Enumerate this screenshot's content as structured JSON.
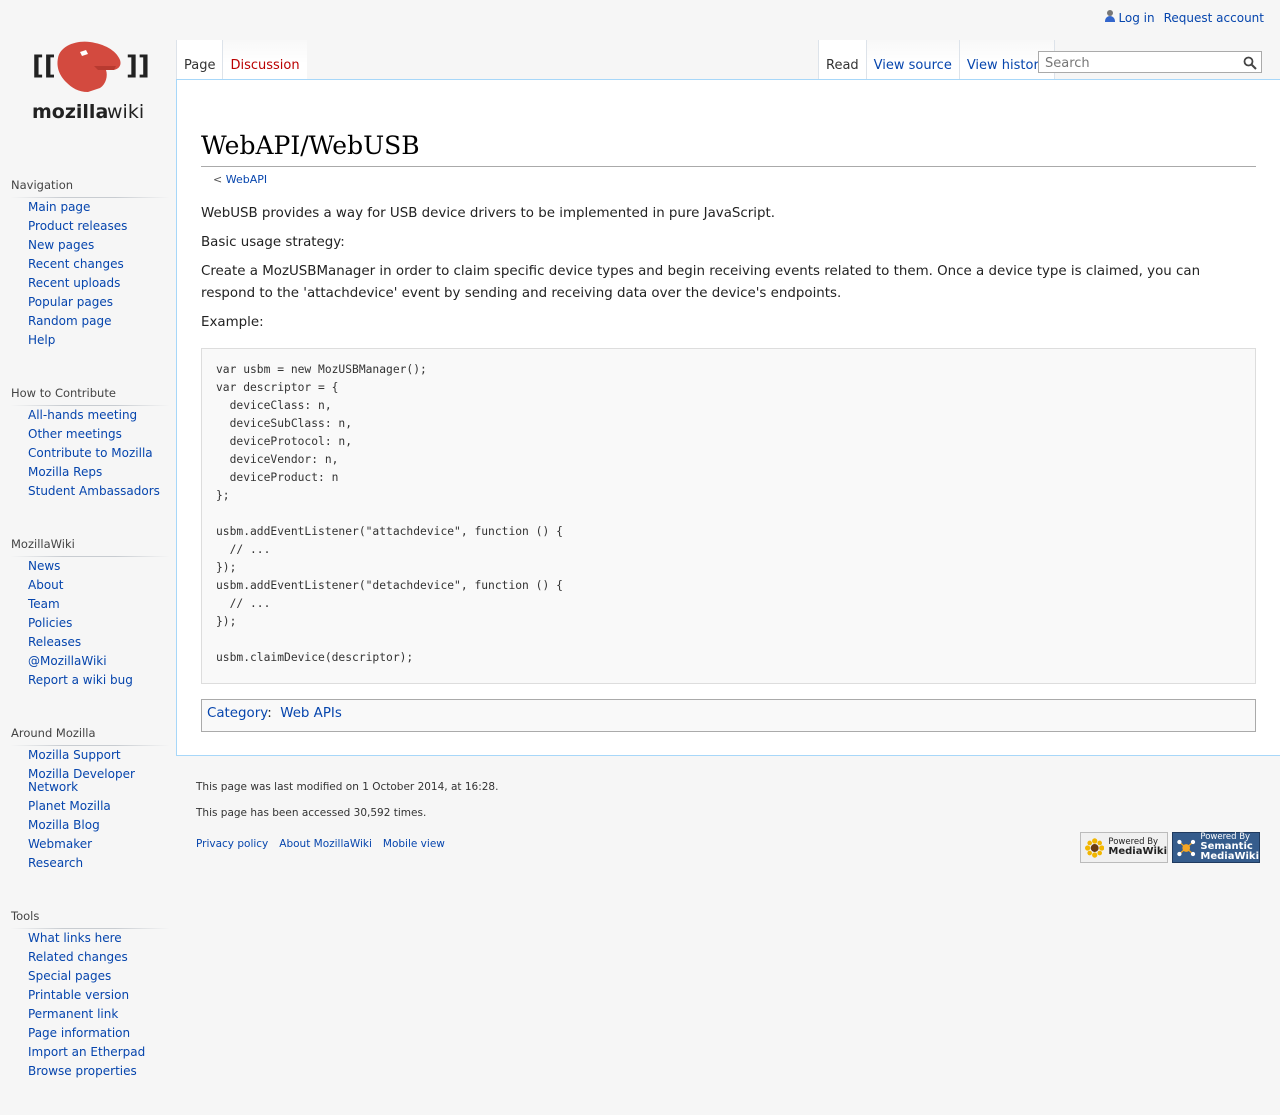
{
  "personal": {
    "login": "Log in",
    "request_account": "Request account"
  },
  "logo": {
    "brackets_left": "[[",
    "brackets_right": "]]",
    "wordmark_bold": "mozilla",
    "wordmark_light": "wiki"
  },
  "tabs_left": [
    "Page",
    "Discussion"
  ],
  "tabs_right": [
    "Read",
    "View source",
    "View history"
  ],
  "search": {
    "placeholder": "Search",
    "button_icon": "search-icon"
  },
  "page": {
    "title": "WebAPI/WebUSB",
    "breadcrumb_prefix": "<",
    "breadcrumb_link": "WebAPI",
    "paragraphs": [
      "WebUSB provides a way for USB device drivers to be implemented in pure JavaScript.",
      "Basic usage strategy:",
      "Create a MozUSBManager in order to claim specific device types and begin receiving events related to them. Once a device type is claimed, you can respond to the 'attachdevice' event by sending and receiving data over the device's endpoints.",
      "Example:"
    ],
    "code": "var usbm = new MozUSBManager();\nvar descriptor = {\n  deviceClass: n,\n  deviceSubClass: n,\n  deviceProtocol: n,\n  deviceVendor: n,\n  deviceProduct: n\n};\n\nusbm.addEventListener(\"attachdevice\", function () {\n  // ...\n});\nusbm.addEventListener(\"detachdevice\", function () {\n  // ...\n});\n\nusbm.claimDevice(descriptor);",
    "category_label": "Category",
    "category_value": "Web APIs"
  },
  "sidebar": {
    "navigation": {
      "heading": "Navigation",
      "items": [
        "Main page",
        "Product releases",
        "New pages",
        "Recent changes",
        "Recent uploads",
        "Popular pages",
        "Random page",
        "Help"
      ]
    },
    "contribute": {
      "heading": "How to Contribute",
      "items": [
        "All-hands meeting",
        "Other meetings",
        "Contribute to Mozilla",
        "Mozilla Reps",
        "Student Ambassadors"
      ]
    },
    "mozillawiki": {
      "heading": "MozillaWiki",
      "items": [
        "News",
        "About",
        "Team",
        "Policies",
        "Releases",
        "@MozillaWiki",
        "Report a wiki bug"
      ]
    },
    "around": {
      "heading": "Around Mozilla",
      "items": [
        "Mozilla Support",
        "Mozilla Developer Network",
        "Planet Mozilla",
        "Mozilla Blog",
        "Webmaker",
        "Research"
      ]
    },
    "tools": {
      "heading": "Tools",
      "items": [
        "What links here",
        "Related changes",
        "Special pages",
        "Printable version",
        "Permanent link",
        "Page information",
        "Import an Etherpad",
        "Browse properties"
      ]
    }
  },
  "footer": {
    "last_modified": "This page was last modified on 1 October 2014, at 16:28.",
    "accessed": "This page has been accessed 30,592 times.",
    "links": [
      "Privacy policy",
      "About MozillaWiki",
      "Mobile view"
    ],
    "badge_mw": {
      "line1": "Powered By",
      "line2": "MediaWiki"
    },
    "badge_smw": {
      "line1": "Powered By",
      "line2": "Semantic",
      "line3": "MediaWiki"
    }
  }
}
